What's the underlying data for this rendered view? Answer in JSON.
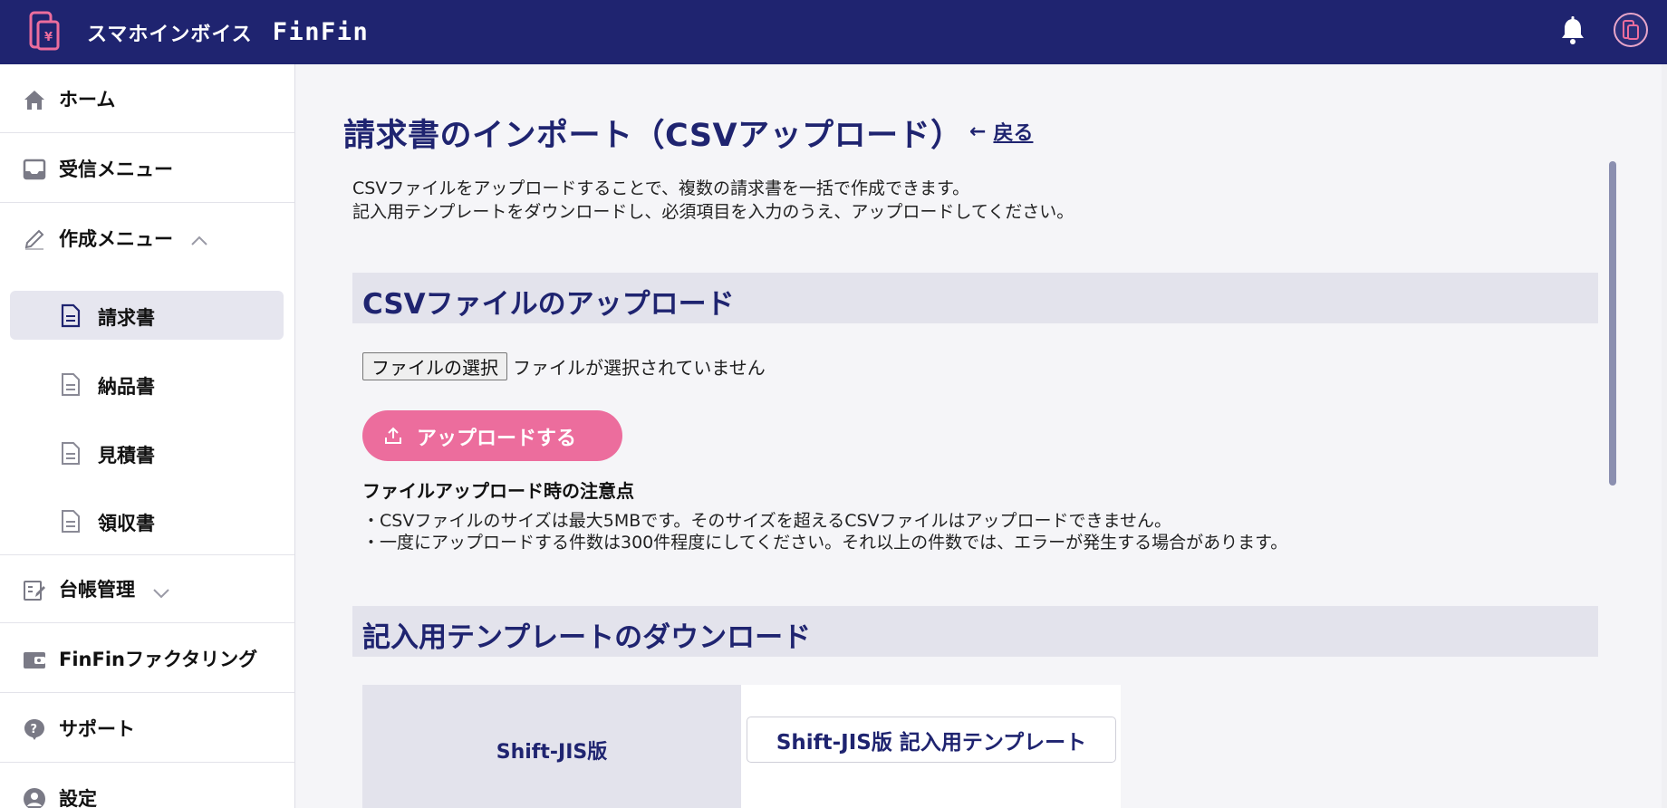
{
  "header": {
    "brand_jp": "スマホインボイス",
    "brand_en": "FinFin"
  },
  "sidebar": {
    "items": [
      {
        "label": "ホーム",
        "icon": "home-icon"
      },
      {
        "label": "受信メニュー",
        "icon": "inbox-icon"
      },
      {
        "label": "作成メニュー",
        "icon": "pencil-icon"
      },
      {
        "label": "台帳管理",
        "icon": "ledger-icon"
      },
      {
        "label": "FinFinファクタリング",
        "icon": "wallet-icon"
      },
      {
        "label": "サポート",
        "icon": "help-icon"
      },
      {
        "label": "設定",
        "icon": "user-icon"
      }
    ],
    "sub_items": [
      {
        "label": "請求書",
        "active": true
      },
      {
        "label": "納品書",
        "active": false
      },
      {
        "label": "見積書",
        "active": false
      },
      {
        "label": "領収書",
        "active": false
      }
    ]
  },
  "main": {
    "title": "請求書のインポート（CSVアップロード）",
    "back_label": "戻る",
    "intro_line1": "CSVファイルをアップロードすることで、複数の請求書を一括で作成できます。",
    "intro_line2": "記入用テンプレートをダウンロードし、必須項目を入力のうえ、アップロードしてください。",
    "upload_section": {
      "title": "CSVファイルのアップロード",
      "file_button": "ファイルの選択",
      "file_status": "ファイルが選択されていません",
      "upload_button": "アップロードする",
      "notes_title": "ファイルアップロード時の注意点",
      "note1": "・CSVファイルのサイズは最大5MBです。そのサイズを超えるCSVファイルはアップロードできません。",
      "note2": "・一度にアップロードする件数は300件程度にしてください。それ以上の件数では、エラーが発生する場合があります。"
    },
    "template_section": {
      "title": "記入用テンプレートのダウンロード",
      "rows": [
        {
          "label": "Shift-JIS版",
          "button": "Shift-JIS版 記入用テンプレート"
        }
      ]
    }
  },
  "colors": {
    "header_bg": "#1f2470",
    "accent_pink": "#ec6d9d",
    "section_bg": "#e3e3ec"
  }
}
